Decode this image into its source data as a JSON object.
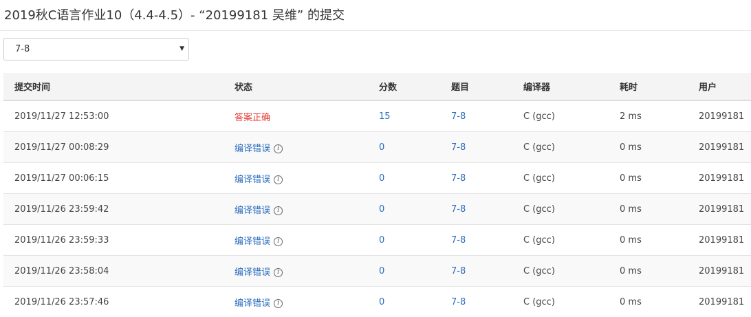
{
  "header": {
    "title": "2019秋C语言作业10（4.4-4.5）- “20199181 吴维” 的提交"
  },
  "filter": {
    "selected": "7-8"
  },
  "table": {
    "columns": [
      "提交时间",
      "状态",
      "分数",
      "题目",
      "编译器",
      "耗时",
      "用户"
    ],
    "rows": [
      {
        "time": "2019/11/27 12:53:00",
        "status": "答案正确",
        "status_kind": "accepted",
        "score": "15",
        "problem": "7-8",
        "compiler": "C (gcc)",
        "duration": "2 ms",
        "user": "20199181"
      },
      {
        "time": "2019/11/27 00:08:29",
        "status": "编译错误",
        "status_kind": "error",
        "score": "0",
        "problem": "7-8",
        "compiler": "C (gcc)",
        "duration": "0 ms",
        "user": "20199181"
      },
      {
        "time": "2019/11/27 00:06:15",
        "status": "编译错误",
        "status_kind": "error",
        "score": "0",
        "problem": "7-8",
        "compiler": "C (gcc)",
        "duration": "0 ms",
        "user": "20199181"
      },
      {
        "time": "2019/11/26 23:59:42",
        "status": "编译错误",
        "status_kind": "error",
        "score": "0",
        "problem": "7-8",
        "compiler": "C (gcc)",
        "duration": "0 ms",
        "user": "20199181"
      },
      {
        "time": "2019/11/26 23:59:33",
        "status": "编译错误",
        "status_kind": "error",
        "score": "0",
        "problem": "7-8",
        "compiler": "C (gcc)",
        "duration": "0 ms",
        "user": "20199181"
      },
      {
        "time": "2019/11/26 23:58:04",
        "status": "编译错误",
        "status_kind": "error",
        "score": "0",
        "problem": "7-8",
        "compiler": "C (gcc)",
        "duration": "0 ms",
        "user": "20199181"
      },
      {
        "time": "2019/11/26 23:57:46",
        "status": "编译错误",
        "status_kind": "error",
        "score": "0",
        "problem": "7-8",
        "compiler": "C (gcc)",
        "duration": "0 ms",
        "user": "20199181"
      }
    ]
  },
  "icons": {
    "error_detail": "info-circle-icon",
    "select_caret": "caret-down-icon"
  },
  "colors": {
    "accepted": "#e53935",
    "link": "#2a6cbf"
  }
}
